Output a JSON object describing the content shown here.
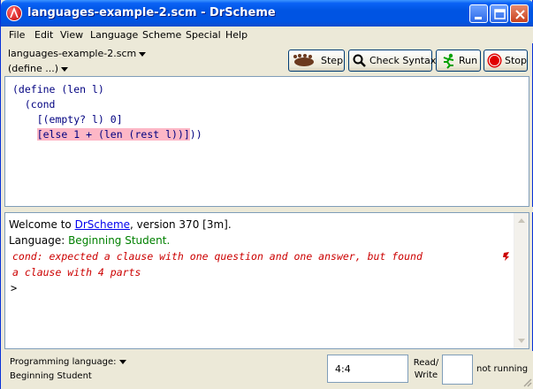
{
  "window": {
    "title": "languages-example-2.scm - DrScheme",
    "controls": {
      "minimize": "minimize-icon",
      "maximize": "maximize-icon",
      "close": "close-icon"
    }
  },
  "menubar": {
    "items": [
      "File",
      "Edit",
      "View",
      "Language",
      "Scheme",
      "Special",
      "Help"
    ]
  },
  "toolbar": {
    "file_dropdown": "languages-example-2.scm",
    "define_dropdown": "(define ...)",
    "buttons": {
      "step": "Step",
      "check_syntax": "Check Syntax",
      "run": "Run",
      "stop": "Stop"
    }
  },
  "definitions": {
    "lines": [
      "(define (len l)",
      "  (cond",
      "    [(empty? l) 0]",
      "    [else 1 + (len (rest l))]))"
    ]
  },
  "interactions": {
    "welcome_prefix": "Welcome to ",
    "welcome_link": "DrScheme",
    "welcome_suffix": ", version 370 [3m].",
    "language_prefix": "Language: ",
    "language_value": "Beginning Student.",
    "error_line1": "cond: expected a clause with one question and one answer, but found",
    "error_line2": "a clause with 4 parts",
    "prompt": ">"
  },
  "status": {
    "language_label": "Programming language:",
    "language_value": "Beginning Student",
    "position": "4:4",
    "read_write_1": "Read/",
    "read_write_2": "Write",
    "running": "not running"
  },
  "colors": {
    "titlebar": "#0054e3",
    "highlight": "#fdb7c6",
    "error": "#cc0000",
    "language_green": "#008000",
    "link": "#0000ee"
  }
}
